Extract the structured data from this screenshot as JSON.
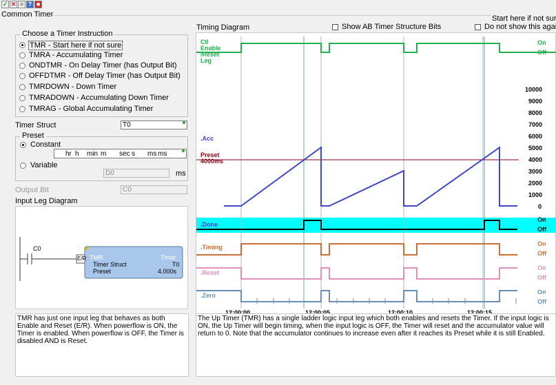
{
  "toolbar": {
    "icons": [
      "check-icon",
      "close-icon",
      "status-icon",
      "help-icon",
      "record-icon"
    ]
  },
  "common_timer": {
    "title": "Common Timer",
    "start_here": "Start here if not sure"
  },
  "choose": {
    "title": "Choose a Timer Instruction",
    "options": [
      "TMR - Start here if not sure",
      "TMRA - Accumulating Timer",
      "ONDTMR - On Delay Timer (has Output Bit)",
      "OFFDTMR - Off Delay Timer (has Output Bit)",
      "TMRDOWN - Down Timer",
      "TMRADOWN - Accumulating Down Timer",
      "TMRAG - Global Accumulating Timer"
    ],
    "selected_index": 0
  },
  "timer_struct": {
    "label": "Timer Struct",
    "value": "T0"
  },
  "preset": {
    "title": "Preset",
    "constant_label": "Constant",
    "variable_label": "Variable",
    "hr": "hr",
    "hr_unit": "h",
    "min": "min",
    "min_unit": "m",
    "sec": "sec",
    "sec_unit": "s",
    "ms": "ms",
    "ms_unit": "ms",
    "variable_value": "D0",
    "variable_unit": "ms"
  },
  "output_bit": {
    "label": "Output Bit",
    "value": "C0"
  },
  "input_leg": {
    "label": "Input Leg Diagram",
    "contact": "C0",
    "er": "E/R",
    "box_title": "TMR",
    "box_title_right": "Timer",
    "row1_label": "Timer Struct",
    "row1_value": "T0",
    "row2_label": "Preset",
    "row2_value": "4.000s"
  },
  "left_description": "TMR has just one input leg that behaves as both Enable and Reset (E/R).  When powerflow is ON, the Timer is enabled.  When powerflow is OFF, the Timer is disabled AND is Reset.",
  "timing": {
    "title": "Timing Diagram",
    "show_ab": "Show AB Timer Structure Bits",
    "do_not_show": "Do not show this again",
    "enable_label": "C0\nEnable\n/Reset\nLeg",
    "acc_label": ".Acc",
    "preset_label": "Preset\n4000ms",
    "done_label": ".Done",
    "timing_label": ".Timing",
    "reset_label": ".Reset",
    "zero_label": ".Zero",
    "on": "On",
    "off": "Off",
    "y_ticks": [
      "10000",
      "9000",
      "8000",
      "7000",
      "6000",
      "5000",
      "4000",
      "3000",
      "2000",
      "1000",
      "0"
    ],
    "x_ticks": [
      "12:00:00",
      "12:00:05",
      "12:00:10",
      "12:00:15"
    ],
    "colors": {
      "enable": "#22b14c",
      "acc": "#3f48cc",
      "preset": "#880015",
      "done_bg": "#00ffff",
      "timing": "#c87137",
      "reset": "#e08fb8",
      "zero": "#6a8fb6"
    }
  },
  "right_description": "The Up Timer (TMR) has a single ladder logic input leg which both enables and resets the Timer. If the input logic is ON, the Up Timer will begin timing, when the input logic is OFF, the Timer will reset and the accumulator value will return to 0. Note that the accumulator continues to increase even after it reaches its Preset while it is still Enabled."
}
